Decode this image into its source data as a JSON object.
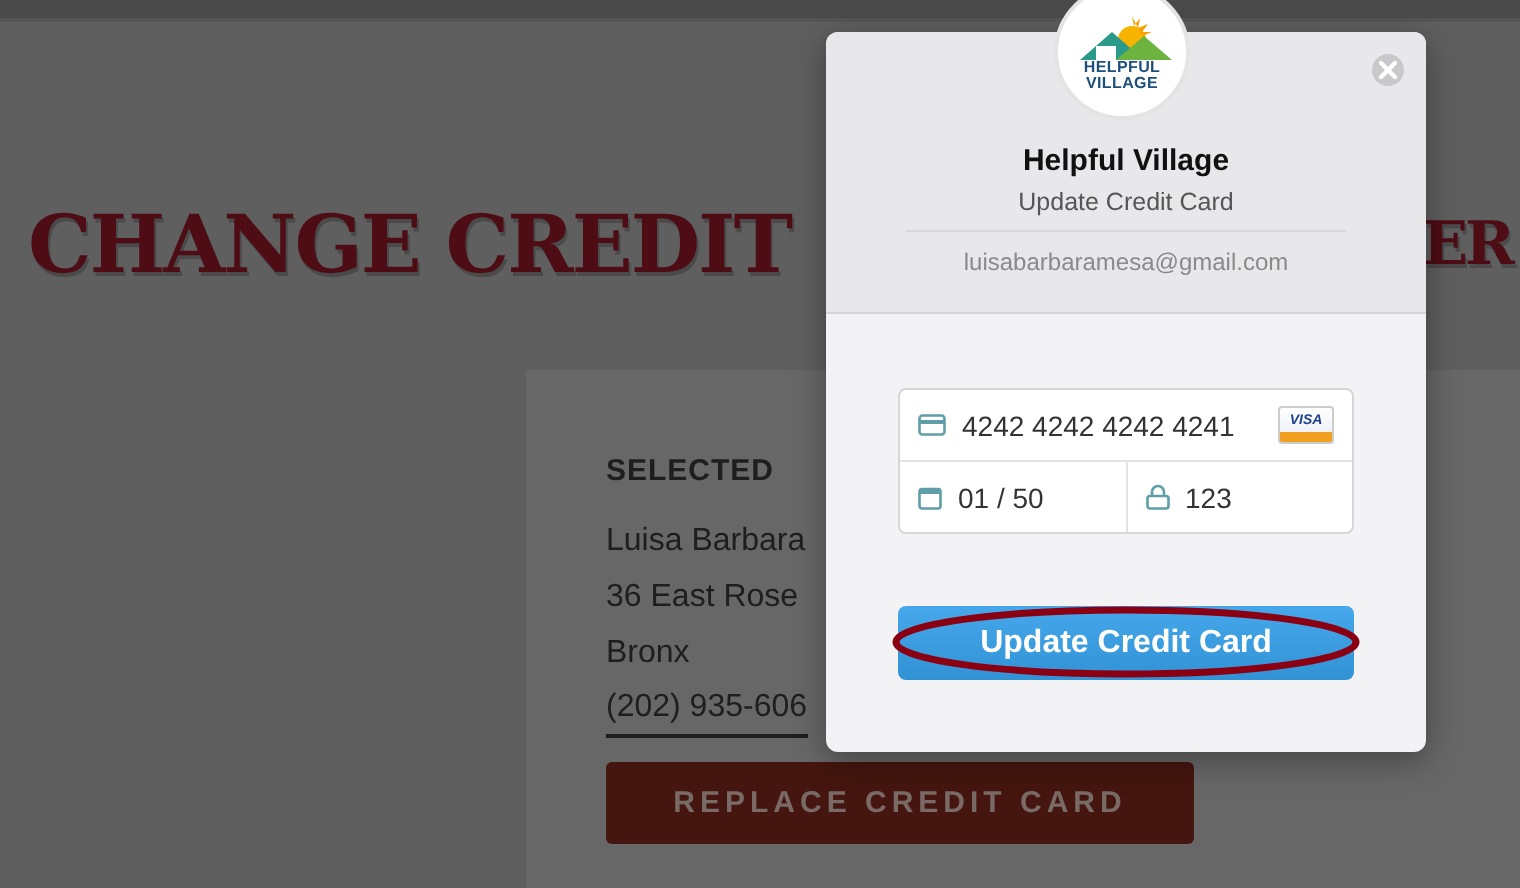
{
  "page": {
    "title_left": "CHANGE CREDIT",
    "title_right": "ER",
    "section_heading": "SELECTED",
    "address_lines": [
      "Luisa Barbara",
      "36 East Rose",
      "Bronx"
    ],
    "phone": "(202) 935-606",
    "replace_button": "REPLACE CREDIT CARD"
  },
  "modal": {
    "logo_lines": [
      "HELPFUL",
      "VILLAGE"
    ],
    "title": "Helpful Village",
    "subtitle": "Update Credit Card",
    "email": "luisabarbaramesa@gmail.com",
    "card_number": "4242 4242 4242 4241",
    "card_brand": "VISA",
    "expiry": "01 / 50",
    "cvc": "123",
    "submit_button": {
      "label": "Update Credit Card",
      "circled": true
    }
  }
}
